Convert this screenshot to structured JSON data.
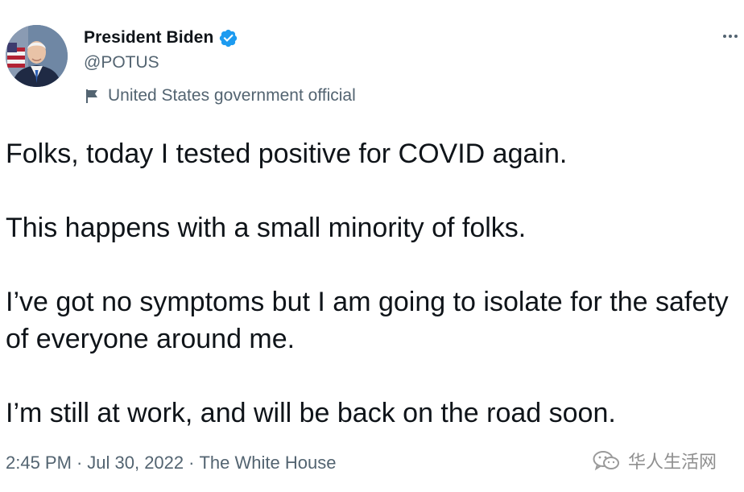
{
  "tweet": {
    "author": {
      "display_name": "President Biden",
      "handle": "@POTUS",
      "verified": true,
      "label": "United States government official"
    },
    "text": {
      "p1": "Folks, today I tested positive for COVID again.",
      "p2": "This happens with a small minority of folks.",
      "p3": "I’ve got no symptoms but I am going to isolate for the safety of everyone around me.",
      "p4": "I’m still at work, and will be back on the road soon."
    },
    "meta": {
      "time": "2:45 PM",
      "date": "Jul 30, 2022",
      "source": "The White House",
      "separator": "·"
    }
  },
  "watermark": {
    "text": "华人生活网",
    "icon": "wechat-icon"
  },
  "colors": {
    "text_primary": "#0f1419",
    "text_secondary": "#536471",
    "verified_blue": "#1d9bf0",
    "background": "#ffffff"
  },
  "icons": {
    "more": "more-options-icon",
    "verified": "verified-badge-icon",
    "label": "flag-icon"
  }
}
